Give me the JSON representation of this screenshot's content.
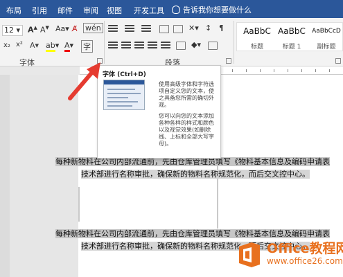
{
  "tabs": [
    "布局",
    "引用",
    "邮件",
    "审阅",
    "视图",
    "开发工具"
  ],
  "tell_me": "告诉我你想要做什么",
  "ribbon": {
    "font_size": "12",
    "group_font": "字体",
    "group_paragraph": "段落",
    "styles": [
      {
        "preview": "AaBbC",
        "name": "标题"
      },
      {
        "preview": "AaBbC",
        "name": "标题 1"
      },
      {
        "preview": "AaBbCcD",
        "name": "副标题"
      }
    ]
  },
  "tooltip": {
    "title": "字体 (Ctrl+D)",
    "desc1": "使用高级字体和字符选项自定义您的文本，使之具备您所需的确切外观。",
    "desc2": "您可以向您的文本添加各种各样的样式和颜色以及视觉效果(如删除线、上标和全部大写字母)。"
  },
  "document": {
    "para1_line1": "每种新物料在公司内部流通前，先由仓库管理员填写《物料基本信息及编码申请表",
    "para1_line2": "技术部进行名称审批，确保新的物料名称规范化，而后交文控中心。",
    "para2_line1": "每种新物料在公司内部流通前，先由仓库管理员填写《物料基本信息及编码申请表",
    "para2_line2": "技术部进行名称审批，确保新的物料名称规范化，而后交文控中心。"
  },
  "watermark": {
    "brand": "Office教程网",
    "url": "www.office26.com"
  },
  "colors": {
    "ribbon_blue": "#2b579a",
    "arrow_red": "#e53b30",
    "brand_orange": "#e8701e"
  }
}
